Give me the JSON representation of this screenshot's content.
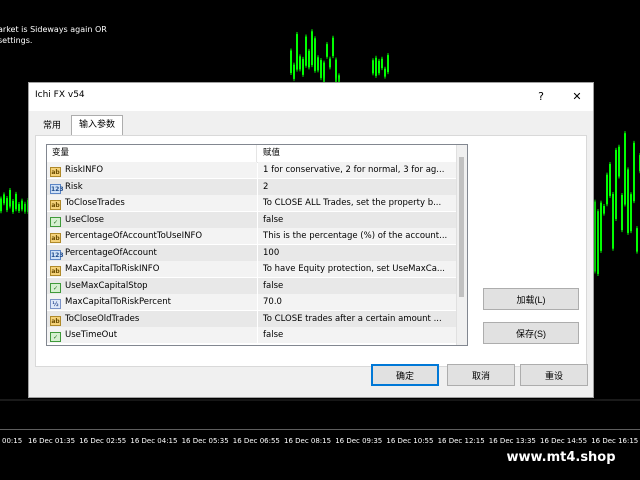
{
  "chart": {
    "note_lines": [
      "arket is Sideways again OR",
      "settings."
    ],
    "time_labels": [
      "00:15",
      "16 Dec 01:35",
      "16 Dec 02:55",
      "16 Dec 04:15",
      "16 Dec 05:35",
      "16 Dec 06:55",
      "16 Dec 08:15",
      "16 Dec 09:35",
      "16 Dec 10:55",
      "16 Dec 12:15",
      "16 Dec 13:35",
      "16 Dec 14:55",
      "16 Dec 16:15"
    ],
    "candle_color": "#00ff00",
    "watermark": "www.mt4.shop"
  },
  "dialog": {
    "title": "Ichi FX v54",
    "help_button": "?",
    "close_button": "✕",
    "tabs": [
      {
        "label": "常用",
        "active": false
      },
      {
        "label": "输入参数",
        "active": true
      }
    ],
    "columns": [
      "变量",
      "赋值"
    ],
    "rows": [
      {
        "icon": "ab",
        "name": "RiskINFO",
        "value": "1 for conservative, 2 for normal, 3 for ag..."
      },
      {
        "icon": "num",
        "name": "Risk",
        "value": "2"
      },
      {
        "icon": "ab",
        "name": "ToCloseTrades",
        "value": "To CLOSE ALL Trades, set the property b..."
      },
      {
        "icon": "chk",
        "name": "UseClose",
        "value": "false"
      },
      {
        "icon": "ab",
        "name": "PercentageOfAccountToUseINFO",
        "value": "This is the percentage (%) of the account..."
      },
      {
        "icon": "num",
        "name": "PercentageOfAccount",
        "value": "100"
      },
      {
        "icon": "ab",
        "name": "MaxCapitalToRiskINFO",
        "value": "To have Equity protection, set UseMaxCa..."
      },
      {
        "icon": "chk",
        "name": "UseMaxCapitalStop",
        "value": "false"
      },
      {
        "icon": "dbl",
        "name": "MaxCapitalToRiskPercent",
        "value": "70.0"
      },
      {
        "icon": "ab",
        "name": "ToCloseOldTrades",
        "value": "To CLOSE trades after a certain amount ..."
      },
      {
        "icon": "chk",
        "name": "UseTimeOut",
        "value": "false"
      }
    ],
    "icon_glyphs": {
      "ab": "ab",
      "num": "123",
      "chk": "✓",
      "dbl": "½"
    },
    "side_buttons": {
      "load": "加载(L)",
      "save": "保存(S)"
    },
    "footer_buttons": {
      "ok": "确定",
      "cancel": "取消",
      "reset": "重设"
    },
    "accent_color": "#0078d7"
  }
}
